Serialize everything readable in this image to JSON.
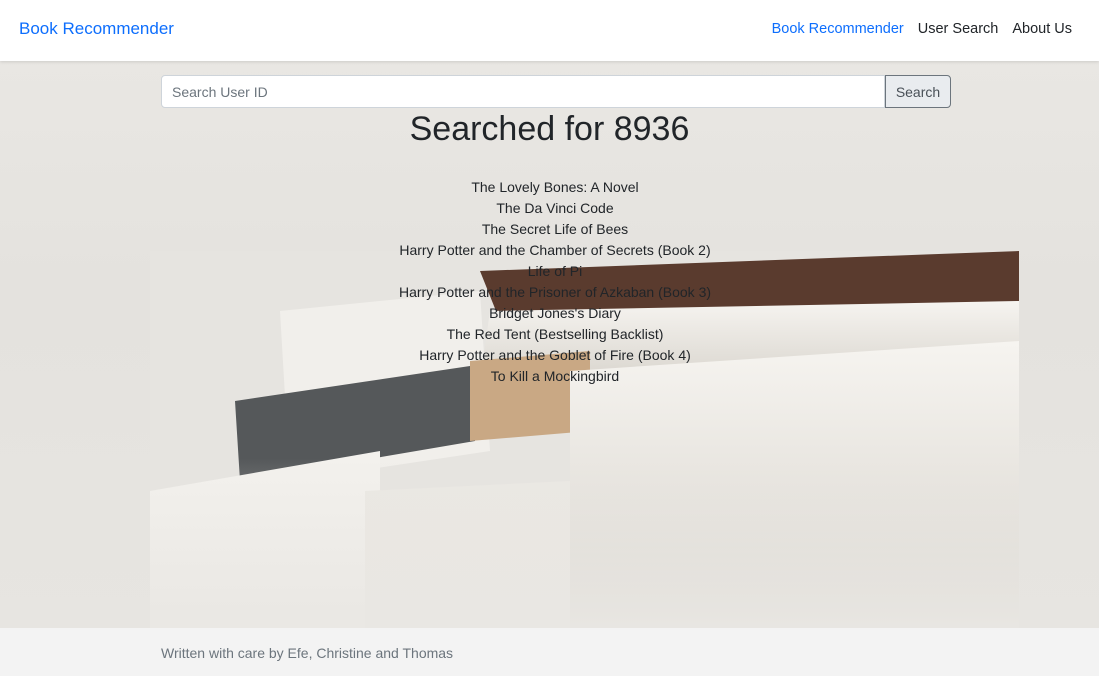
{
  "navbar": {
    "brand": "Book Recommender",
    "links": [
      {
        "label": "Book Recommender",
        "active": true
      },
      {
        "label": "User Search",
        "active": false
      },
      {
        "label": "About Us",
        "active": false
      }
    ]
  },
  "search": {
    "placeholder": "Search User ID",
    "value": "",
    "button_label": "Search"
  },
  "results": {
    "heading": "Searched for 8936",
    "books": [
      "The Lovely Bones: A Novel",
      "The Da Vinci Code",
      "The Secret Life of Bees",
      "Harry Potter and the Chamber of Secrets (Book 2)",
      "Life of Pi",
      "Harry Potter and the Prisoner of Azkaban (Book 3)",
      "Bridget Jones's Diary",
      "The Red Tent (Bestselling Backlist)",
      "Harry Potter and the Goblet of Fire (Book 4)",
      "To Kill a Mockingbird"
    ]
  },
  "footer": {
    "text": "Written with care by Efe, Christine and Thomas"
  },
  "colors": {
    "accent": "#0d6efd",
    "text": "#212529",
    "muted": "#6c757d"
  }
}
